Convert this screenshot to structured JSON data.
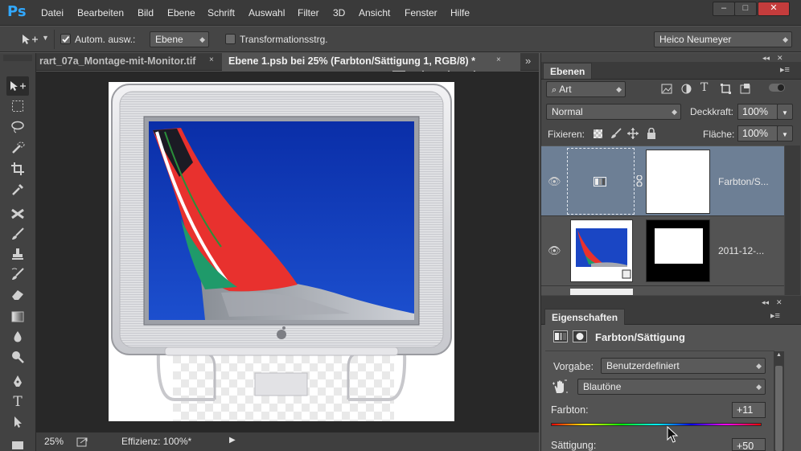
{
  "app": {
    "logo": "Ps"
  },
  "menu": [
    "Datei",
    "Bearbeiten",
    "Bild",
    "Ebene",
    "Schrift",
    "Auswahl",
    "Filter",
    "3D",
    "Ansicht",
    "Fenster",
    "Hilfe"
  ],
  "window_controls": {
    "minimize": "–",
    "maximize": "□",
    "close": "✕"
  },
  "options": {
    "auto_select_label": "Autom. ausw.:",
    "auto_select_checked": true,
    "auto_select_value": "Ebene",
    "transform_label": "Transformationsstrg.",
    "transform_checked": false,
    "workspace": "Heico Neumeyer"
  },
  "tabs": [
    {
      "label": "rart_07a_Montage-mit-Monitor.tif",
      "close": "×"
    },
    {
      "label": "Ebene 1.psb bei 25% (Farbton/Sättigung 1, RGB/8) *",
      "close": "×"
    }
  ],
  "tab_overflow": "»",
  "status": {
    "zoom": "25%",
    "info": "Effizienz: 100%*",
    "arrow": "▶"
  },
  "layers_panel": {
    "title": "Ebenen",
    "filter": "Art",
    "blend_mode": "Normal",
    "opacity_label": "Deckkraft:",
    "opacity": "100%",
    "lock_label": "Fixieren:",
    "fill_label": "Fläche:",
    "fill": "100%",
    "layers": [
      {
        "name": "Farbton/S...",
        "selected": true
      },
      {
        "name": "2011-12-...",
        "selected": false
      }
    ]
  },
  "properties_panel": {
    "title": "Eigenschaften",
    "heading": "Farbton/Sättigung",
    "preset_label": "Vorgabe:",
    "preset": "Benutzerdefiniert",
    "range": "Blautöne",
    "hue_label": "Farbton:",
    "hue_value": "+11",
    "sat_label": "Sättigung:",
    "sat_value": "+50",
    "hue_slider_position": 0.74
  },
  "colors": {
    "accent": "#31a8ff",
    "selected_layer": "#6d7f95",
    "close_red": "#c43c3c"
  }
}
